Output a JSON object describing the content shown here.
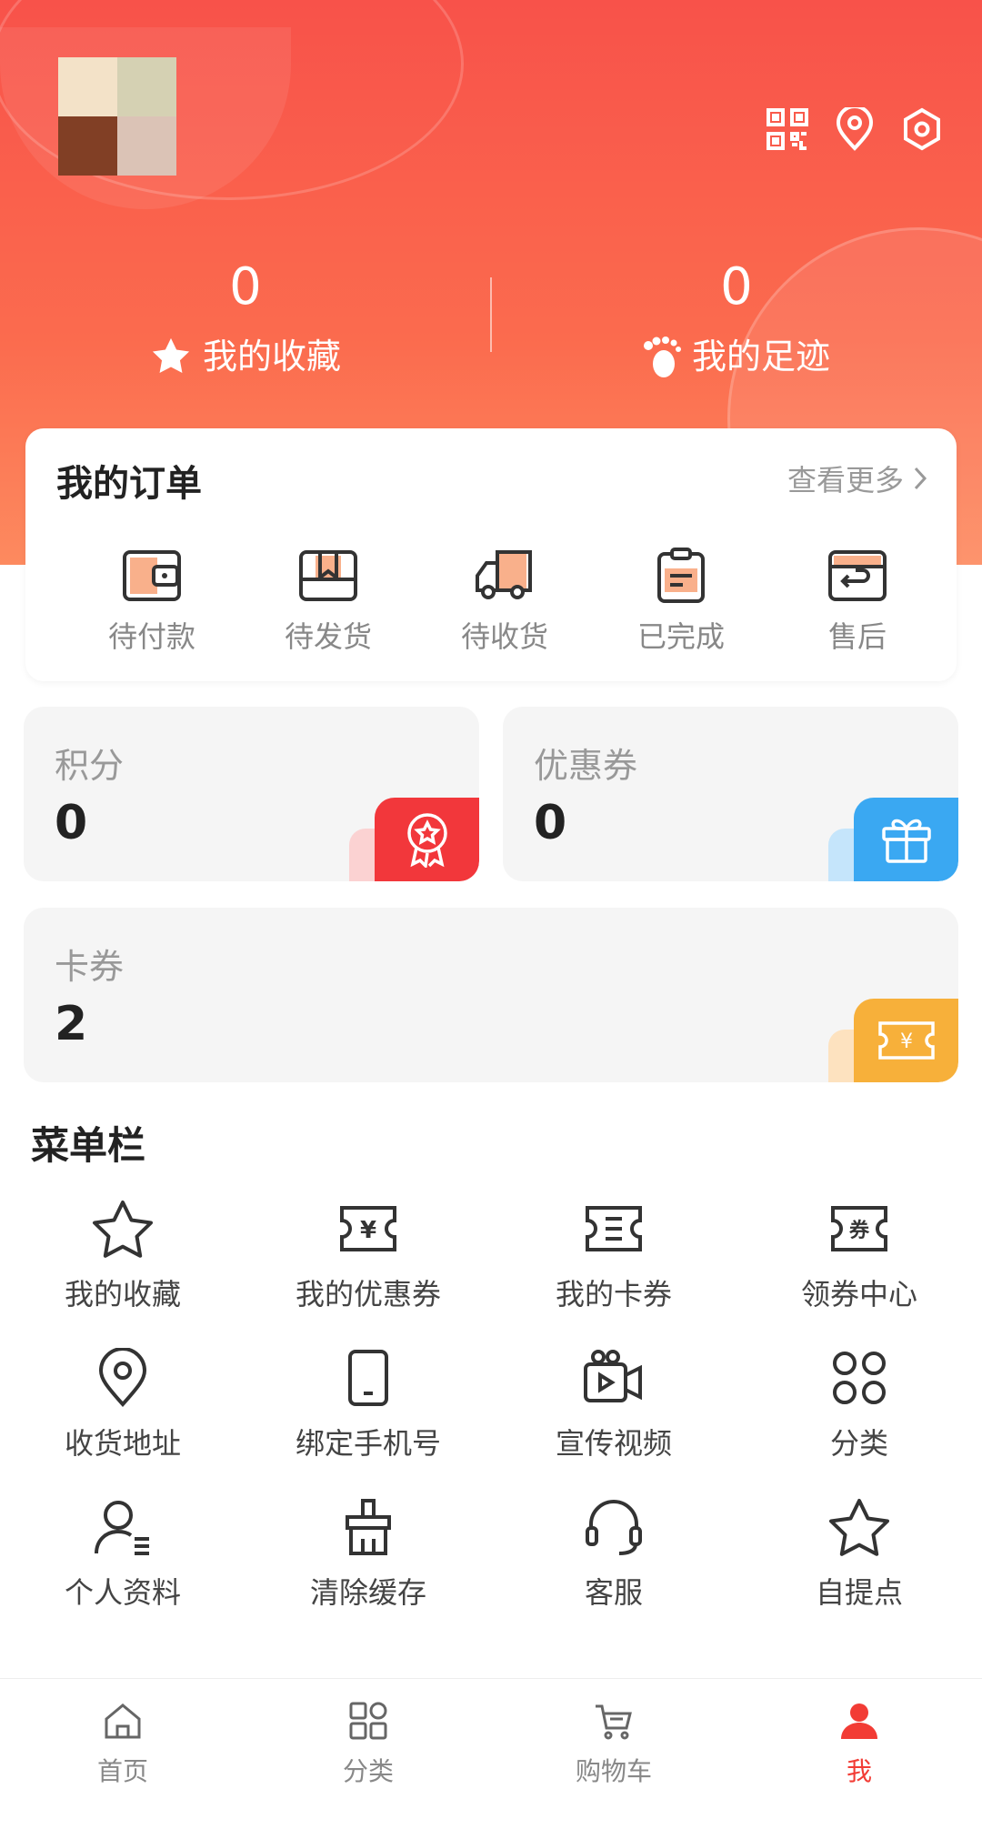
{
  "colors": {
    "primary": "#f23c35",
    "header_gradient": [
      "#f8524a",
      "#fd8a5f"
    ],
    "points_badge": "#f2373b",
    "coupon_badge": "#3aa8f2",
    "card_badge": "#f7b03a"
  },
  "header": {
    "avatar_colors": [
      "#f3e2c8",
      "#d5d1b3",
      "#813f25",
      "#dbc3b6"
    ],
    "icons": [
      "qrcode-icon",
      "location-icon",
      "settings-icon"
    ],
    "favorites": {
      "count": "0",
      "label": "我的收藏"
    },
    "footprints": {
      "count": "0",
      "label": "我的足迹"
    }
  },
  "orders": {
    "title": "我的订单",
    "more": "查看更多",
    "items": [
      {
        "label": "待付款",
        "icon": "wallet-icon"
      },
      {
        "label": "待发货",
        "icon": "package-icon"
      },
      {
        "label": "待收货",
        "icon": "truck-icon"
      },
      {
        "label": "已完成",
        "icon": "clipboard-icon"
      },
      {
        "label": "售后",
        "icon": "after-sale-icon"
      }
    ]
  },
  "assets": {
    "points": {
      "label": "积分",
      "value": "0"
    },
    "coupons": {
      "label": "优惠券",
      "value": "0"
    },
    "cards": {
      "label": "卡券",
      "value": "2"
    }
  },
  "menu": {
    "title": "菜单栏",
    "items": [
      {
        "label": "我的收藏",
        "icon": "star-icon"
      },
      {
        "label": "我的优惠券",
        "icon": "yen-ticket-icon"
      },
      {
        "label": "我的卡券",
        "icon": "card-ticket-icon"
      },
      {
        "label": "领券中心",
        "icon": "coupon-center-icon"
      },
      {
        "label": "收货地址",
        "icon": "location-pin-icon"
      },
      {
        "label": "绑定手机号",
        "icon": "phone-icon"
      },
      {
        "label": "宣传视频",
        "icon": "video-camera-icon"
      },
      {
        "label": "分类",
        "icon": "grid-icon"
      },
      {
        "label": "个人资料",
        "icon": "profile-icon"
      },
      {
        "label": "清除缓存",
        "icon": "broom-icon"
      },
      {
        "label": "客服",
        "icon": "headset-icon"
      },
      {
        "label": "自提点",
        "icon": "star-outline-icon"
      }
    ]
  },
  "tabbar": {
    "items": [
      {
        "label": "首页",
        "icon": "home-icon"
      },
      {
        "label": "分类",
        "icon": "category-icon"
      },
      {
        "label": "购物车",
        "icon": "cart-icon"
      },
      {
        "label": "我",
        "icon": "user-icon"
      }
    ],
    "active_index": 3
  }
}
